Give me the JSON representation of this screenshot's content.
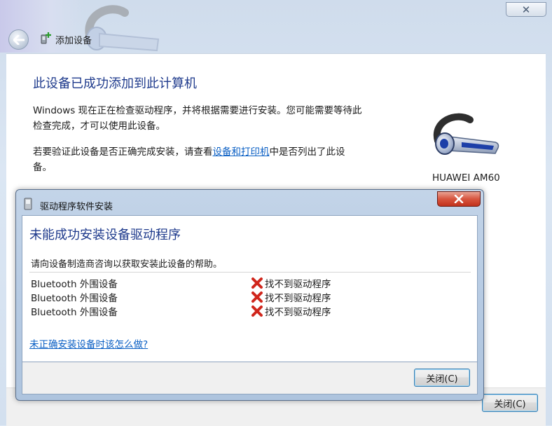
{
  "window": {
    "title": "添加设备",
    "close_glyph": "✕"
  },
  "main": {
    "heading": "此设备已成功添加到此计算机",
    "para1": "Windows 现在正在检查驱动程序，并将根据需要进行安装。您可能需要等待此检查完成，才可以使用此设备。",
    "para2_before": "若要验证此设备是否正确完成安装，请查看",
    "para2_link": "设备和打印机",
    "para2_after": "中是否列出了此设备。",
    "device_name": "HUAWEI AM60",
    "device_icon": "headset-icon"
  },
  "footer": {
    "close_label": "关闭(C)"
  },
  "dialog": {
    "title": "驱动程序软件安装",
    "heading": "未能成功安装设备驱动程序",
    "subtext": "请向设备制造商咨询以获取安装此设备的帮助。",
    "rows": [
      {
        "device": "Bluetooth 外围设备",
        "status": "找不到驱动程序"
      },
      {
        "device": "Bluetooth 外围设备",
        "status": "找不到驱动程序"
      },
      {
        "device": "Bluetooth 外围设备",
        "status": "找不到驱动程序"
      }
    ],
    "help_link": "未正确安装设备时该怎么做?",
    "close_label": "关闭(C)"
  },
  "colors": {
    "heading_blue": "#1e3a8c",
    "link_blue": "#0a5fc4",
    "error_red": "#d0261c"
  }
}
